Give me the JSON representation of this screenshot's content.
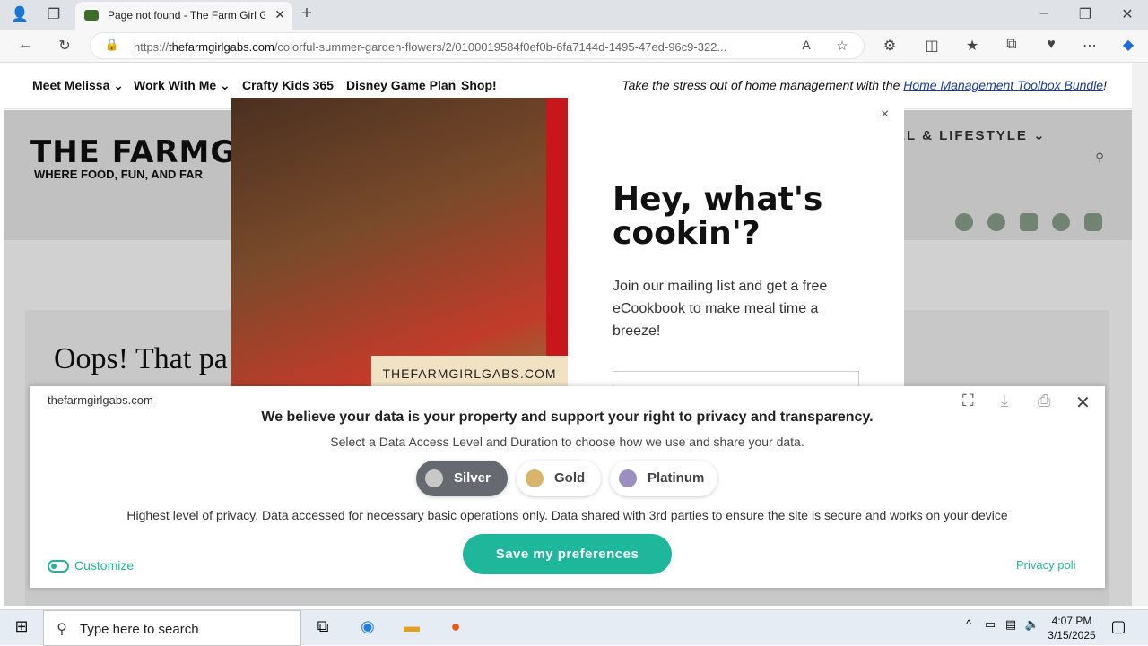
{
  "browser": {
    "tab_title": "Page not found - The Farm Girl G",
    "url_prefix": "https://",
    "url_domain": "thefarmgirlgabs.com",
    "url_rest": "/colorful-summer-garden-flowers/2/0100019584f0ef0b-6fa7144d-1495-47ed-96c9-322..."
  },
  "nav": {
    "items": [
      "Meet Melissa ⌄",
      "Work With Me ⌄",
      "Crafty Kids 365",
      "Disney Game Plan",
      "Shop!"
    ],
    "promo_prefix": "Take the stress out of home management with the",
    "promo_link": "Home Management Toolbox Bundle",
    "promo_suffix": "!"
  },
  "site": {
    "logo": "THE FARMG",
    "tagline": "WHERE FOOD, FUN, AND FAR",
    "lifestyle": "EL & LIFESTYLE ⌄",
    "oops": "Oops! That pa"
  },
  "modal": {
    "brand": "THEFARMGIRLGABS.COM",
    "title": "Hey, what's cookin'?",
    "text": "Join our mailing list and get a free eCookbook to make meal time a breeze!",
    "close": "×"
  },
  "consent": {
    "domain": "thefarmgirlgabs.com",
    "heading": "We believe your data is your property and support your right to privacy and transparency.",
    "subheading": "Select a Data Access Level and Duration to choose how we use and share your data.",
    "levels": [
      {
        "label": "Silver",
        "color": "#c8c8c8"
      },
      {
        "label": "Gold",
        "color": "#d8b56a"
      },
      {
        "label": "Platinum",
        "color": "#9b8fbf"
      }
    ],
    "description": "Highest level of privacy. Data accessed for necessary basic operations only. Data shared with 3rd parties to ensure the site is secure and works on your device",
    "save_label": "Save my preferences",
    "customize_label": "Customize",
    "privacy_label": "Privacy poli"
  },
  "taskbar": {
    "search_placeholder": "Type here to search",
    "time": "4:07 PM",
    "date": "3/15/2025"
  }
}
